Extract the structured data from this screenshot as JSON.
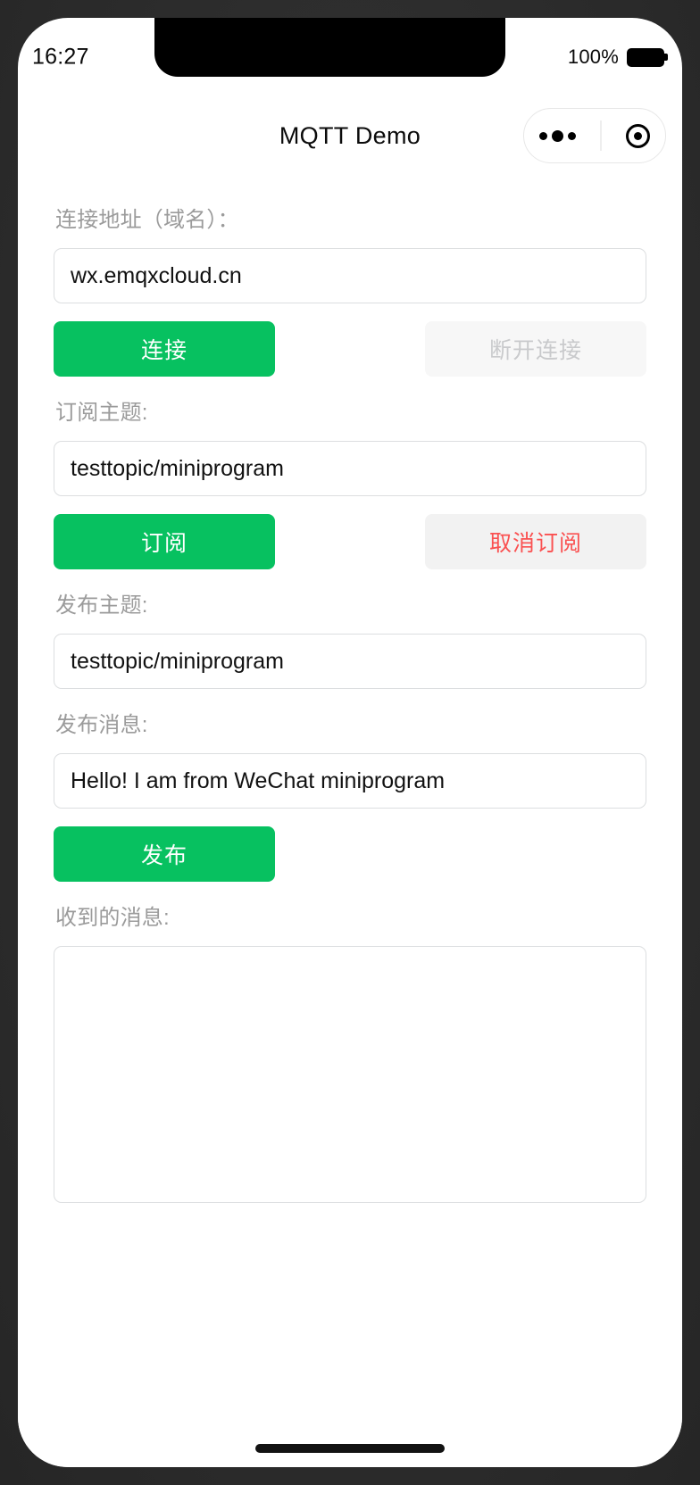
{
  "status_bar": {
    "time": "16:27",
    "battery_percent": "100%",
    "battery_level": 100
  },
  "nav_bar": {
    "title": "MQTT Demo",
    "capsule": {
      "menu_icon": "more-dots-icon",
      "target_icon": "target-circle-icon"
    }
  },
  "form": {
    "host": {
      "label": "连接地址（域名）：",
      "value": "wx.emqxcloud.cn",
      "placeholder": ""
    },
    "connect_button": "连接",
    "disconnect_button": "断开连接",
    "subscribe_topic": {
      "label": "订阅主题:",
      "value": "testtopic/miniprogram",
      "placeholder": ""
    },
    "subscribe_button": "订阅",
    "unsubscribe_button": "取消订阅",
    "publish_topic": {
      "label": "发布主题:",
      "value": "testtopic/miniprogram",
      "placeholder": ""
    },
    "publish_message": {
      "label": "发布消息:",
      "value": "Hello! I am from WeChat miniprogram",
      "placeholder": ""
    },
    "publish_button": "发布",
    "received": {
      "label": "收到的消息:",
      "value": ""
    }
  },
  "colors": {
    "brand_green": "#07C160",
    "danger_red": "#FA5151",
    "disabled_text": "#C9CACC",
    "disabled_bg": "#F7F7F7",
    "danger_bg": "#F2F2F2",
    "label_gray": "#9B9B9B",
    "input_border": "#DCDEE0",
    "device_frame": "#2E2E2E"
  }
}
